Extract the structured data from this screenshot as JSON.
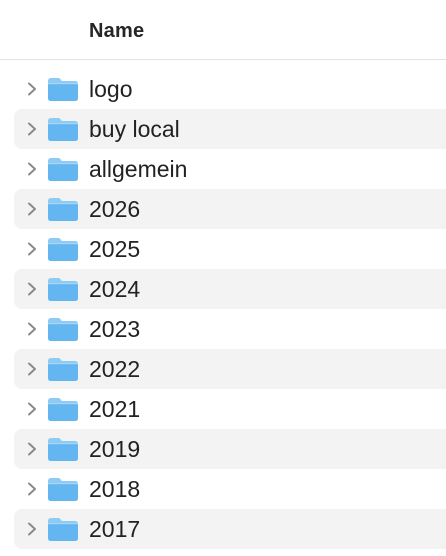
{
  "header": {
    "title": "Name"
  },
  "colors": {
    "folder_body": "#63b6ef",
    "folder_tab": "#8ccbf5",
    "row_alt_background": "#f3f3f4",
    "chevron": "#8a8a8e"
  },
  "icons": {
    "disclosure": "chevron-right-icon",
    "item": "folder-icon"
  },
  "items": [
    {
      "label": "logo"
    },
    {
      "label": "buy local"
    },
    {
      "label": "allgemein"
    },
    {
      "label": "2026"
    },
    {
      "label": "2025"
    },
    {
      "label": "2024"
    },
    {
      "label": "2023"
    },
    {
      "label": "2022"
    },
    {
      "label": "2021"
    },
    {
      "label": "2019"
    },
    {
      "label": "2018"
    },
    {
      "label": "2017"
    }
  ]
}
